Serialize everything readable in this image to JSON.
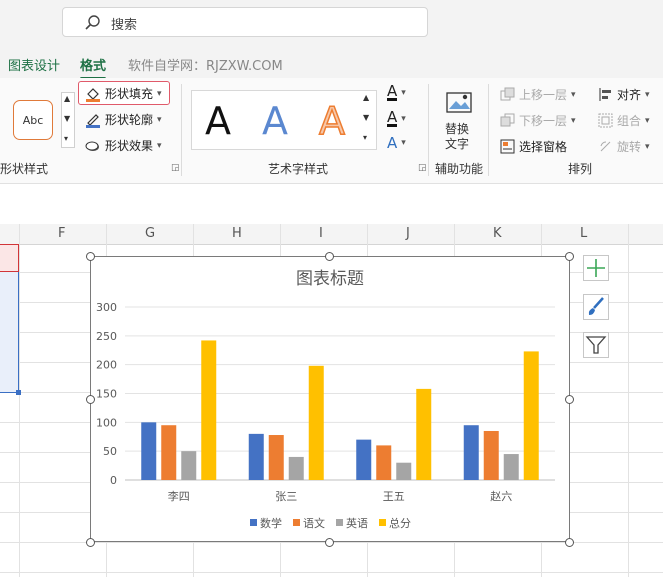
{
  "search": {
    "placeholder": "搜索"
  },
  "tabs": [
    {
      "label": "图表设计",
      "style": "green"
    },
    {
      "label": "格式",
      "style": "active"
    },
    {
      "label": "软件自学网：RJZXW.COM",
      "style": "gray"
    }
  ],
  "ribbon": {
    "shape_styles": {
      "sample_label": "Abc",
      "fill_label": "形状填充",
      "outline_label": "形状轮廓",
      "effect_label": "形状效果",
      "group_label": "形状样式"
    },
    "wordart": {
      "letters": [
        "A",
        "A",
        "A"
      ],
      "text_fill_icon": "A",
      "text_outline_icon": "A",
      "text_effect_icon": "A",
      "group_label": "艺术字样式"
    },
    "accessibility": {
      "alt_text_line1": "替换",
      "alt_text_line2": "文字",
      "group_label": "辅助功能"
    },
    "arrange": {
      "bring_forward": "上移一层",
      "send_backward": "下移一层",
      "selection_pane": "选择窗格",
      "align": "对齐",
      "group": "组合",
      "rotate": "旋转",
      "group_label": "排列"
    }
  },
  "columns": [
    "F",
    "G",
    "H",
    "I",
    "J",
    "K",
    "L"
  ],
  "colors": {
    "green": "#1e7145",
    "accent_red": "#d13438"
  },
  "chart_data": {
    "type": "bar",
    "title": "图表标题",
    "categories": [
      "李四",
      "张三",
      "王五",
      "赵六"
    ],
    "series": [
      {
        "name": "数学",
        "color": "#4472c4",
        "values": [
          100,
          80,
          70,
          95
        ]
      },
      {
        "name": "语文",
        "color": "#ed7d31",
        "values": [
          95,
          78,
          60,
          85
        ]
      },
      {
        "name": "英语",
        "color": "#a5a5a5",
        "values": [
          50,
          40,
          30,
          45
        ]
      },
      {
        "name": "总分",
        "color": "#ffc000",
        "values": [
          242,
          198,
          158,
          223
        ]
      }
    ],
    "yticks": [
      "0",
      "50",
      "100",
      "150",
      "200",
      "250",
      "300"
    ],
    "ylim": [
      0,
      300
    ],
    "grid": true,
    "legend": "bottom"
  }
}
